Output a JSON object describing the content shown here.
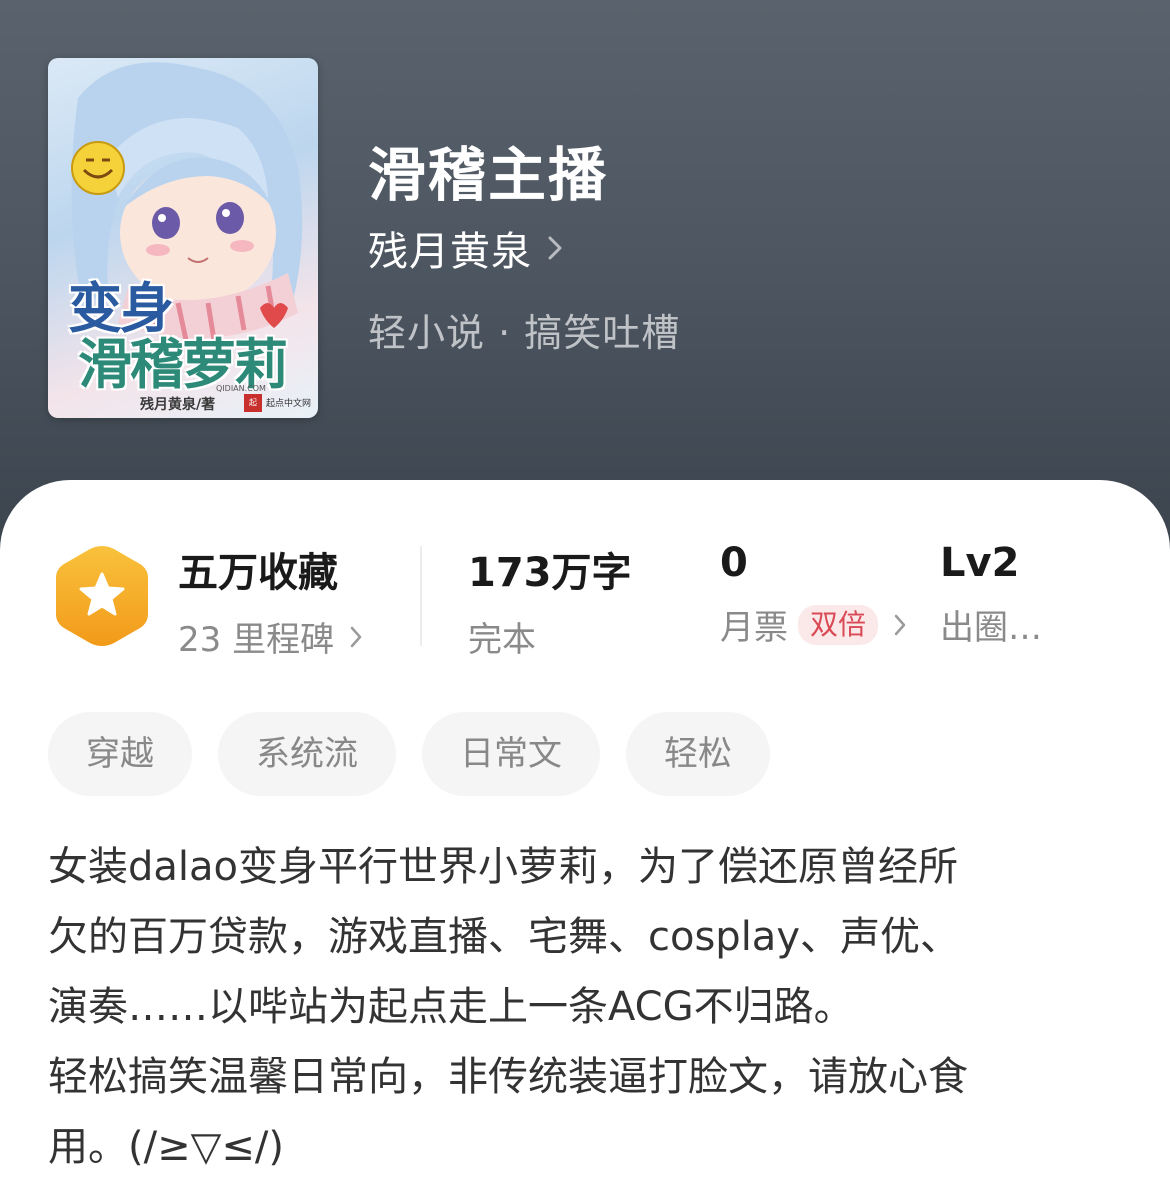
{
  "book": {
    "title": "滑稽主播",
    "author": "残月黄泉",
    "genre": "轻小说 · 搞笑吐槽",
    "cover": {
      "title_line1": "变身",
      "title_line2": "滑稽萝莉",
      "author": "残月黄泉/著",
      "site": "QIDIAN.COM",
      "logo": "起点中文网"
    }
  },
  "stats": {
    "favorites": {
      "value": "五万收藏",
      "sub": "23 里程碑"
    },
    "words": {
      "value": "173万字",
      "sub": "完本"
    },
    "tickets": {
      "value": "0",
      "sub": "月票",
      "badge": "双倍"
    },
    "level": {
      "value": "Lv2",
      "sub": "出圈…"
    }
  },
  "tags": [
    "穿越",
    "系统流",
    "日常文",
    "轻松"
  ],
  "description": [
    "女装dalao变身平行世界小萝莉，为了偿还原曾经所",
    "欠的百万贷款，游戏直播、宅舞、cosplay、声优、",
    "演奏……以哔站为起点走上一条ACG不归路。",
    "轻松搞笑温馨日常向，非传统装逼打脸文，请放心食",
    "用。(/≥▽≤/)"
  ],
  "colors": {
    "header_bg": "#4c5560",
    "badge_orange": "#f5a623",
    "double_badge_text": "#d94a55",
    "double_badge_bg": "#fbe9ea"
  },
  "icons": {
    "badge": "star-hexagon-icon",
    "chevron": "chevron-right-icon"
  }
}
